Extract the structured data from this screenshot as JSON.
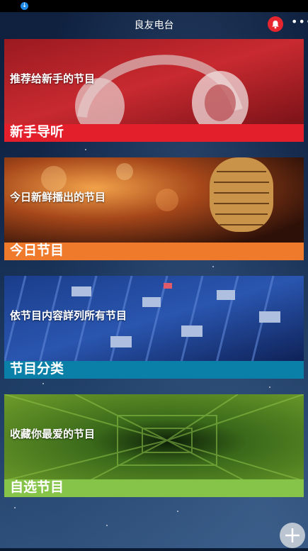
{
  "app": {
    "title": "良友电台"
  },
  "colors": {
    "card1_bar": "#e21f2a",
    "card2_bar": "#f07a2c",
    "card3_bar": "#0a7fa8",
    "card4_bar": "#86c449",
    "bell_bg": "#e5262f"
  },
  "cards": [
    {
      "subtitle": "推荐给新手的节目",
      "category": "新手导听",
      "image": "headphones"
    },
    {
      "subtitle": "今日新鲜播出的节目",
      "category": "今日节目",
      "image": "microphone"
    },
    {
      "subtitle": "依节目内容詳列所有节目",
      "category": "节目分类",
      "image": "mixing-console"
    },
    {
      "subtitle": "收藏你最爱的节目",
      "category": "自选节目",
      "image": "green-tunnel"
    }
  ],
  "icons": {
    "notification": "bell-icon",
    "more": "more-dots-icon",
    "add": "plus-icon",
    "status": "download-status-icon"
  }
}
